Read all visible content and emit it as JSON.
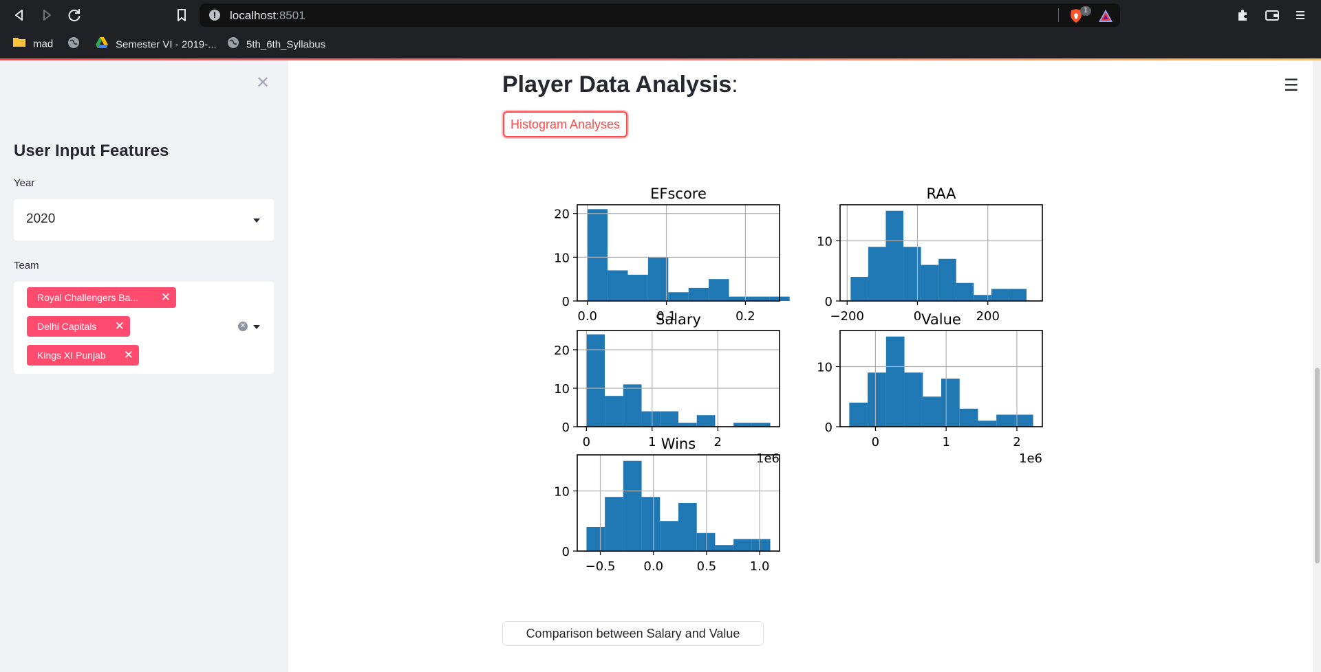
{
  "browser": {
    "url_host": "localhost",
    "url_port": ":8501",
    "brave_badge": "1",
    "bookmarks": [
      {
        "label": "mad",
        "icon": "folder-icon"
      },
      {
        "label": "",
        "icon": "globe-icon"
      },
      {
        "label": "Semester VI - 2019-...",
        "icon": "drive-icon"
      },
      {
        "label": "5th_6th_Syllabus",
        "icon": "globe-icon"
      }
    ]
  },
  "sidebar": {
    "close_glyph": "✕",
    "title": "User Input Features",
    "year_label": "Year",
    "year_value": "2020",
    "team_label": "Team",
    "teams": [
      "Royal Challengers Ba...",
      "Delhi Capitals",
      "Kings XI Punjab"
    ]
  },
  "main": {
    "title": "Player Data Analysis",
    "title_colon": ":",
    "histogram_button": "Histogram Analyses",
    "compare_button": "Comparison between Salary and Value",
    "menu_glyph": "☰"
  },
  "colors": {
    "accent": "#ff4b4b",
    "tag": "#ff4b6e",
    "bar": "#1f77b4",
    "sidebar_bg": "#f0f2f6"
  },
  "chart_data": [
    {
      "type": "bar",
      "title": "EFscore",
      "bin_edges": [
        0.0,
        0.0256,
        0.0512,
        0.0768,
        0.1024,
        0.128,
        0.1536,
        0.1792,
        0.2048,
        0.2304,
        0.256
      ],
      "values": [
        21,
        7,
        6,
        10,
        2,
        3,
        5,
        1,
        1,
        1
      ],
      "xlim": [
        -0.0128,
        0.2432
      ],
      "ylim": [
        0,
        22
      ],
      "xticks": [
        0.0,
        0.1,
        0.2
      ],
      "xtick_labels": [
        "0.0",
        "0.1",
        "0.2"
      ],
      "yticks": [
        0,
        10,
        20
      ],
      "ytick_labels": [
        "0",
        "10",
        "20"
      ],
      "offset_label": "",
      "grid": true
    },
    {
      "type": "bar",
      "title": "RAA",
      "bin_edges": [
        -190,
        -140,
        -90,
        -40,
        10,
        60,
        110,
        160,
        210,
        260,
        310
      ],
      "values": [
        4,
        9,
        15,
        9,
        6,
        7,
        3,
        1,
        2,
        2
      ],
      "xlim": [
        -220,
        355
      ],
      "ylim": [
        0,
        16
      ],
      "xticks": [
        -200,
        0,
        200
      ],
      "xtick_labels": [
        "−200",
        "0",
        "200"
      ],
      "yticks": [
        0,
        10
      ],
      "ytick_labels": [
        "0",
        "10"
      ],
      "offset_label": "",
      "grid": true
    },
    {
      "type": "bar",
      "title": "Salary",
      "bin_edges": [
        0,
        0.28,
        0.56,
        0.84,
        1.12,
        1.4,
        1.68,
        1.96,
        2.24,
        2.52,
        2.8
      ],
      "values": [
        24,
        8,
        11,
        4,
        4,
        1,
        3,
        0,
        1,
        1
      ],
      "xlim": [
        -0.14,
        2.94
      ],
      "ylim": [
        0,
        25
      ],
      "xticks": [
        0,
        1,
        2
      ],
      "xtick_labels": [
        "0",
        "1",
        "2"
      ],
      "yticks": [
        0,
        10,
        20
      ],
      "ytick_labels": [
        "0",
        "10",
        "20"
      ],
      "offset_label": "1e6",
      "grid": true
    },
    {
      "type": "bar",
      "title": "Value",
      "bin_edges": [
        -0.37,
        -0.11,
        0.15,
        0.41,
        0.67,
        0.93,
        1.19,
        1.45,
        1.71,
        1.97,
        2.23
      ],
      "values": [
        4,
        9,
        15,
        9,
        5,
        8,
        3,
        1,
        2,
        2
      ],
      "xlim": [
        -0.5,
        2.36
      ],
      "ylim": [
        0,
        16
      ],
      "xticks": [
        0,
        1,
        2
      ],
      "xtick_labels": [
        "0",
        "1",
        "2"
      ],
      "yticks": [
        0,
        10
      ],
      "ytick_labels": [
        "0",
        "10"
      ],
      "offset_label": "1e6",
      "grid": true
    },
    {
      "type": "bar",
      "title": "Wins",
      "bin_edges": [
        -0.63,
        -0.457,
        -0.284,
        -0.111,
        0.062,
        0.235,
        0.408,
        0.581,
        0.754,
        0.927,
        1.1
      ],
      "values": [
        4,
        9,
        15,
        9,
        5,
        8,
        3,
        1,
        2,
        2
      ],
      "xlim": [
        -0.717,
        1.187
      ],
      "ylim": [
        0,
        16
      ],
      "xticks": [
        -0.5,
        0.0,
        0.5,
        1.0
      ],
      "xtick_labels": [
        "−0.5",
        "0.0",
        "0.5",
        "1.0"
      ],
      "yticks": [
        0,
        10
      ],
      "ytick_labels": [
        "0",
        "10"
      ],
      "offset_label": "",
      "grid": true
    }
  ]
}
